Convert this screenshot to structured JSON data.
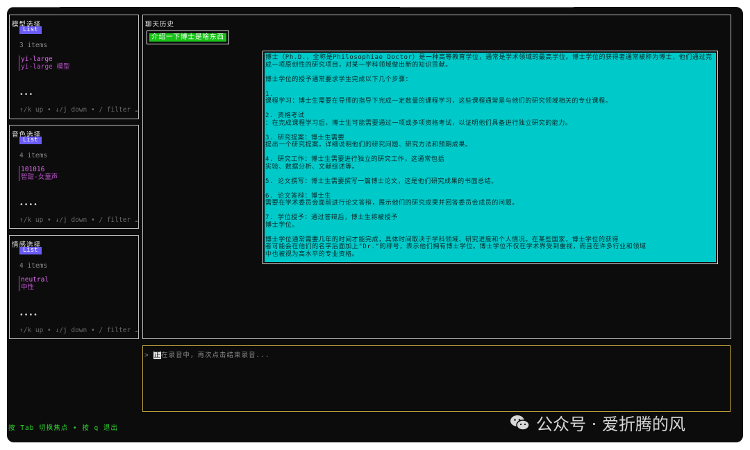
{
  "panels": {
    "model": {
      "title": "模型选择",
      "badge": "List",
      "count": "3 items",
      "selected_title": "yi-large",
      "selected_desc": "yi-large 模型",
      "dots": "•••",
      "help": "↑/k up • ↓/j down • / filter …"
    },
    "voice": {
      "title": "音色选择",
      "badge": "List",
      "count": "4 items",
      "selected_title": "101016",
      "selected_desc": "智甜-女童声",
      "dots": "••••",
      "help": "↑/k up • ↓/j down • / filter …"
    },
    "emotion": {
      "title": "情感选择",
      "badge": "List",
      "count": "4 items",
      "selected_title": "neutral",
      "selected_desc": "中性",
      "dots": "••••",
      "help": "↑/k up • ↓/j down • / filter …"
    }
  },
  "chat": {
    "title": "聊天历史",
    "user_message": "介绍一下博士是啥东西",
    "bot_paragraphs": [
      "博士（Ph.D.，全称是Philosophiae Doctor）是一种高等教育学位，通常是学术领域的最高学位。博士学位的获得者通常被称为博士，他们通过完成一项原创性的研究项目，对某一学科领域做出新的知识贡献。",
      "博士学位的授予通常要求学生完成以下几个步骤：",
      "1.\n课程学习：博士生需要在导师的指导下完成一定数量的课程学习，这些课程通常是与他们的研究领域相关的专业课程。",
      "2. 资格考试\n：在完成课程学习后，博士生可能需要通过一项或多项资格考试，以证明他们具备进行独立研究的能力。",
      "3. 研究提案：博士生需要\n提出一个研究提案，详细说明他们的研究问题、研究方法和预期成果。",
      "4. 研究工作：博士生需要进行独立的研究工作，这通常包括\n实验、数据分析、文献综述等。",
      "5. 论文撰写：博士生需要撰写一篇博士论文，这是他们研究成果的书面总结。",
      "6. 论文答辩：博士生\n需要在学术委员会面前进行论文答辩，展示他们的研究成果并回答委员会成员的问题。",
      "7. 学位授予：通过答辩后，博士生将被授予\n博士学位。",
      "博士学位通常需要几年的时间才能完成，具体时间取决于学科领域、研究进度和个人情况。在某些国家，博士学位的获得\n者可能会在他们的名字后面加上\"Dr.\"的称号，表示他们拥有博士学位。博士学位不仅在学术界受到重视，而且在许多行业和领域\n中也被视为高水平的专业资格。"
    ]
  },
  "input": {
    "prompt": ">",
    "caret_char": "正",
    "text": "在录音中，再次点击结束录音..."
  },
  "footer": {
    "hint": "按 Tab 切换焦点 • 按 q 退出"
  },
  "watermark": {
    "text": "公众号 · 爱折腾的风",
    "icon": "wechat-icon"
  }
}
